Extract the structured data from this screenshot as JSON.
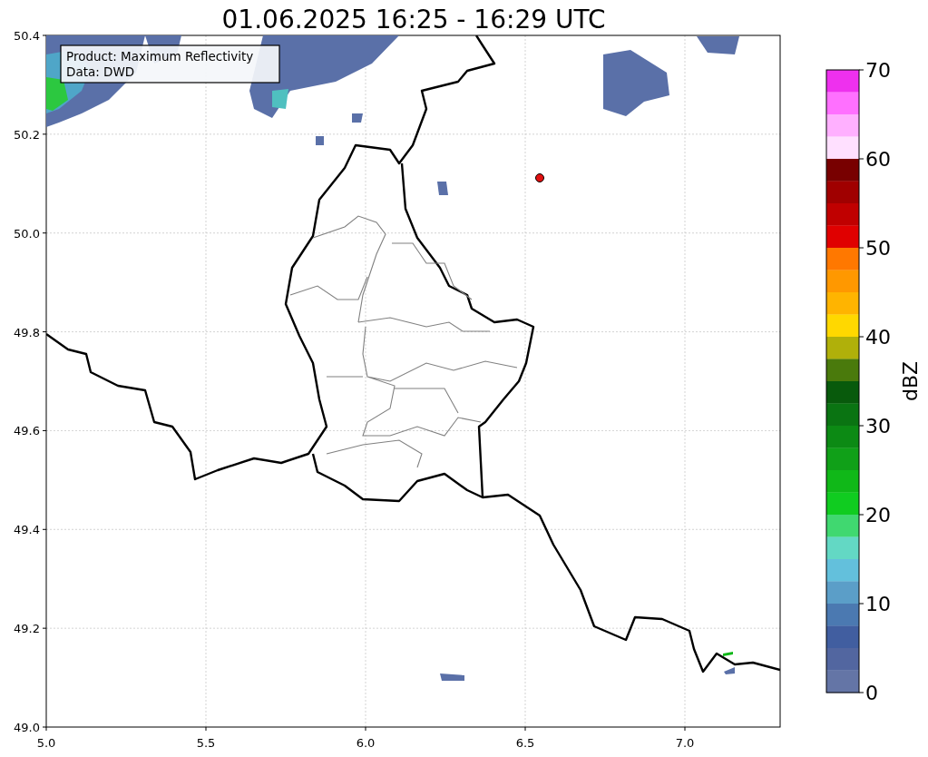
{
  "title": "01.06.2025 16:25 - 16:29 UTC",
  "map": {
    "legend": [
      "Product: Maximum Reflectivity",
      "Data: DWD"
    ],
    "x_ticks": [
      "5.0",
      "5.5",
      "6.0",
      "6.5",
      "7.0"
    ],
    "y_ticks": [
      "50.4",
      "50.2",
      "50.0",
      "49.8",
      "49.6",
      "49.4",
      "49.2",
      "49.0"
    ]
  },
  "colorbar": {
    "label": "dBZ",
    "ticks": [
      "70",
      "60",
      "50",
      "40",
      "30",
      "20",
      "10",
      "0"
    ],
    "bands": [
      {
        "color": "#ee30ee"
      },
      {
        "color": "#ff70ff"
      },
      {
        "color": "#ffb0ff"
      },
      {
        "color": "#ffe0ff"
      },
      {
        "color": "#780000"
      },
      {
        "color": "#a00000"
      },
      {
        "color": "#c00000"
      },
      {
        "color": "#e00000"
      },
      {
        "color": "#ff7800"
      },
      {
        "color": "#ff9800"
      },
      {
        "color": "#ffb400"
      },
      {
        "color": "#ffd800"
      },
      {
        "color": "#b0b00a"
      },
      {
        "color": "#4a7a0c"
      },
      {
        "color": "#085a0c"
      },
      {
        "color": "#0a7412"
      },
      {
        "color": "#0c8a14"
      },
      {
        "color": "#10a018"
      },
      {
        "color": "#10b818"
      },
      {
        "color": "#10cc20"
      },
      {
        "color": "#40d870"
      },
      {
        "color": "#63d8c4"
      },
      {
        "color": "#63c0dc"
      },
      {
        "color": "#5b9ec8"
      },
      {
        "color": "#4b79b1"
      },
      {
        "color": "#415ea0"
      },
      {
        "color": "#5266a0"
      },
      {
        "color": "#6475a6"
      }
    ]
  }
}
